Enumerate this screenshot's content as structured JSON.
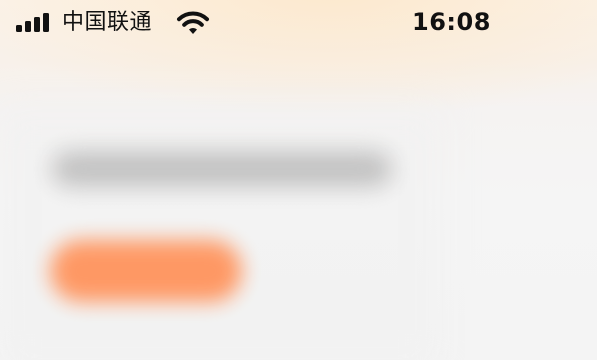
{
  "status_bar": {
    "carrier": "中国联通",
    "time": "16:08",
    "signal_icon": "signal-bars-icon",
    "wifi_icon": "wifi-icon"
  },
  "colors": {
    "accent": "#ff945d",
    "placeholder": "#bdbdbd",
    "text": "#111111"
  }
}
